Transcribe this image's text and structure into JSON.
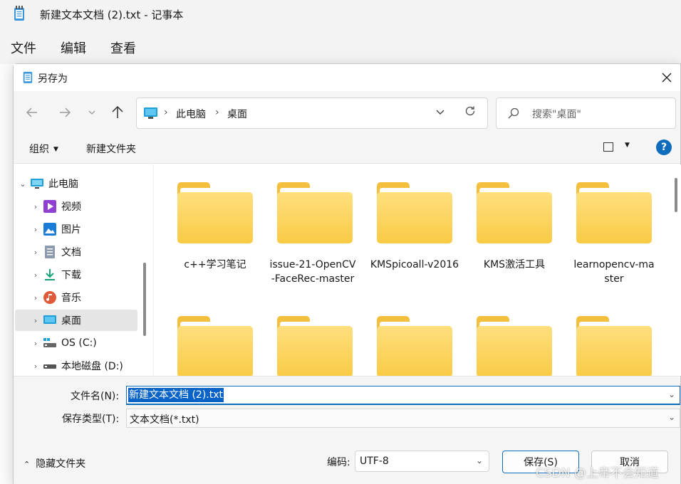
{
  "notepad": {
    "title": "新建文本文档 (2).txt - 记事本",
    "menu": [
      "文件",
      "编辑",
      "查看"
    ]
  },
  "dialog": {
    "title": "另存为",
    "close_icon": "close-icon",
    "address": {
      "crumbs": [
        "此电脑",
        "桌面"
      ]
    },
    "search": {
      "placeholder": "搜索\"桌面\""
    },
    "commands": {
      "organize": "组织",
      "new_folder": "新建文件夹"
    },
    "help": "?",
    "tree": [
      {
        "label": "此电脑",
        "icon": "computer-icon",
        "expanded": true
      },
      {
        "label": "视频",
        "icon": "videos-icon"
      },
      {
        "label": "图片",
        "icon": "pictures-icon"
      },
      {
        "label": "文档",
        "icon": "documents-icon"
      },
      {
        "label": "下载",
        "icon": "downloads-icon"
      },
      {
        "label": "音乐",
        "icon": "music-icon"
      },
      {
        "label": "桌面",
        "icon": "desktop-icon",
        "selected": true
      },
      {
        "label": "OS (C:)",
        "icon": "drive-icon"
      },
      {
        "label": "本地磁盘 (D:)",
        "icon": "drive-icon"
      }
    ],
    "folders": [
      {
        "name": "c++学习笔记"
      },
      {
        "name": "issue-21-OpenCV-FaceRec-master"
      },
      {
        "name": "KMSpicoall-v2016"
      },
      {
        "name": "KMS激活工具"
      },
      {
        "name": "learnopencv-master"
      },
      {
        "name": ""
      },
      {
        "name": ""
      },
      {
        "name": ""
      },
      {
        "name": ""
      },
      {
        "name": ""
      }
    ],
    "filename": {
      "label": "文件名(N):",
      "value": "新建文本文档 (2).txt"
    },
    "filetype": {
      "label": "保存类型(T):",
      "value": "文本文档(*.txt)"
    },
    "hide_folders": "隐藏文件夹",
    "encoding": {
      "label": "编码:",
      "value": "UTF-8"
    },
    "save_label": "保存(S)",
    "cancel_label": "取消"
  },
  "watermark": "CSDN @上帝不会知道",
  "colors": {
    "accent": "#0f6cbd",
    "folder": "#f9cb45",
    "selection": "#0a64c8"
  }
}
